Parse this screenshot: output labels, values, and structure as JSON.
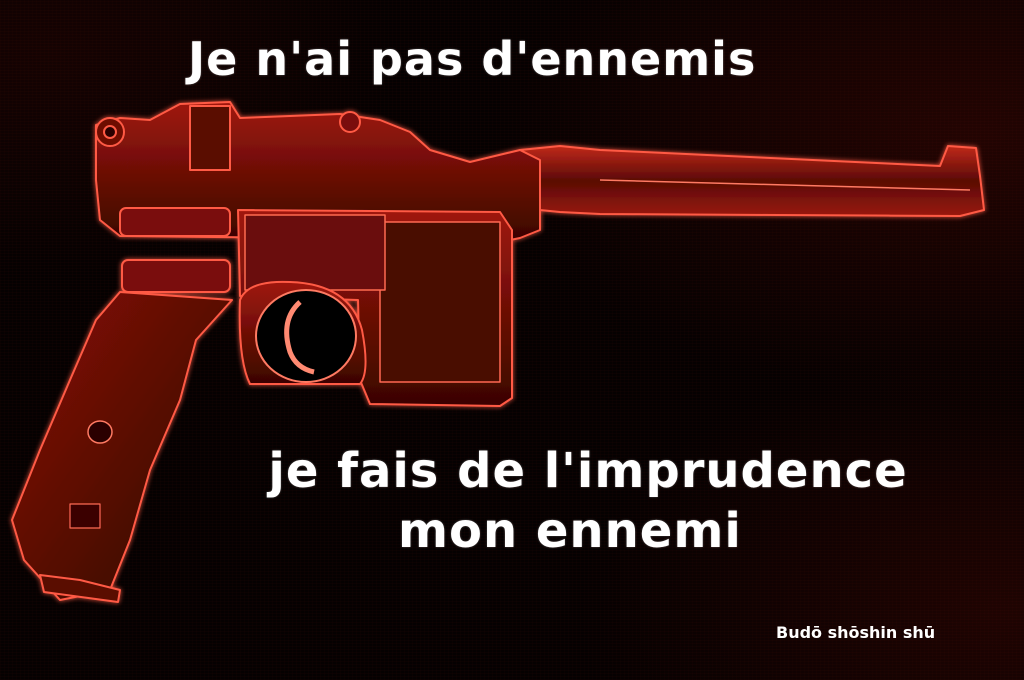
{
  "quote": {
    "line1": "Je n'ai pas d'ennemis",
    "line2": "je fais de l'imprudence",
    "line3": "mon ennemi"
  },
  "attribution": "Budō shōshin shū",
  "image": {
    "subject": "pistol-icon",
    "colors": {
      "background": "#050101",
      "glow": "#ff3a2a",
      "body": "#8a1208",
      "dark": "#3a0503",
      "text": "#ffffff"
    }
  }
}
